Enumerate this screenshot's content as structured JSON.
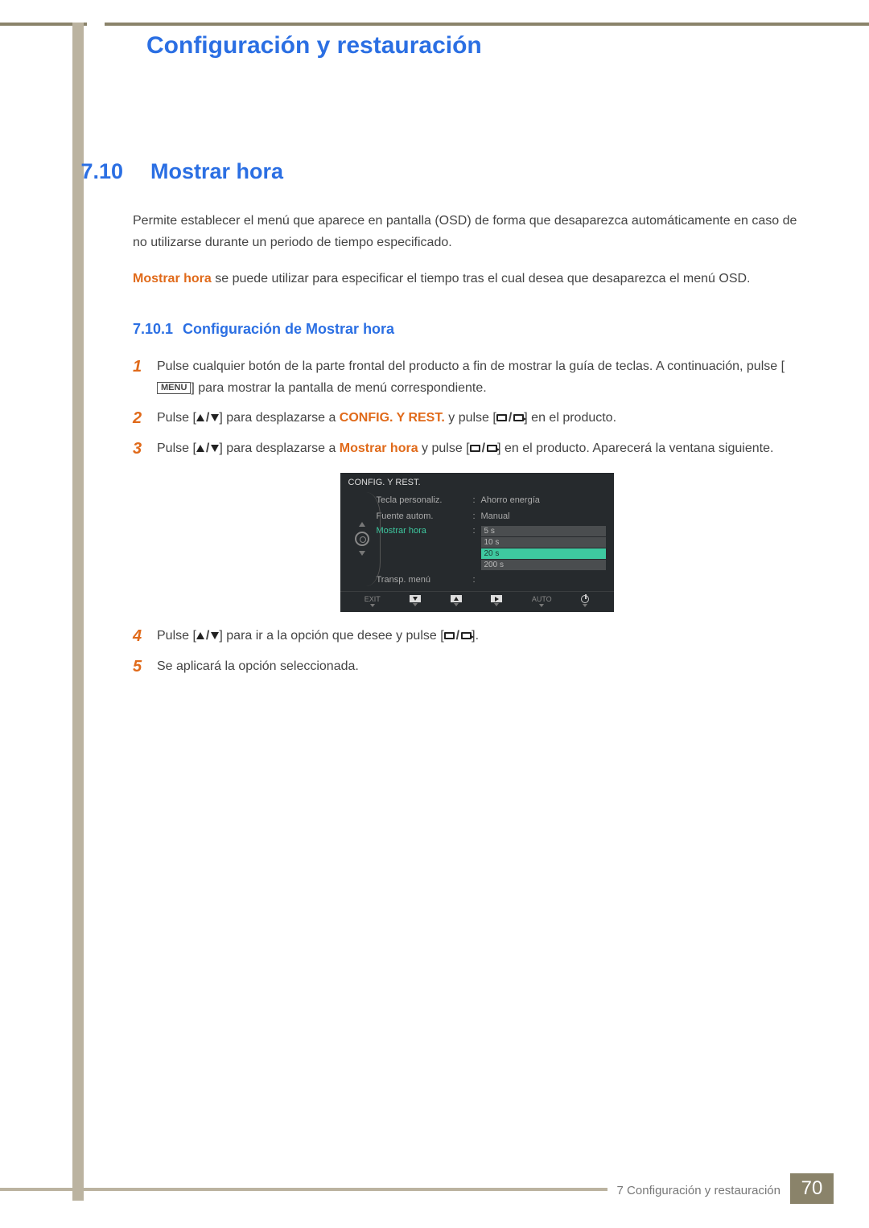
{
  "header": {
    "title": "Configuración y restauración"
  },
  "section": {
    "number": "7.10",
    "title": "Mostrar hora",
    "intro1": "Permite establecer el menú que aparece en pantalla (OSD) de forma que desaparezca automáticamente en caso de no utilizarse durante un periodo de tiempo especificado.",
    "intro2a": "Mostrar hora",
    "intro2b": " se puede utilizar para especificar el tiempo tras el cual desea que desaparezca el menú OSD."
  },
  "subsection": {
    "number": "7.10.1",
    "title": "Configuración de Mostrar hora"
  },
  "steps": {
    "s1a": "Pulse cualquier botón de la parte frontal del producto a fin de mostrar la guía de teclas. A continuación, pulse [",
    "s1menu": "MENU",
    "s1b": "] para mostrar la pantalla de menú correspondiente.",
    "s2a": "Pulse [",
    "s2b": "] para desplazarse a ",
    "s2c": "CONFIG. Y REST.",
    "s2d": " y pulse [",
    "s2e": "] en el producto.",
    "s3a": "Pulse [",
    "s3b": "] para desplazarse a ",
    "s3c": "Mostrar hora",
    "s3d": " y pulse [",
    "s3e": "] en el producto. Aparecerá la ventana siguiente.",
    "s4a": "Pulse [",
    "s4b": "] para ir a la opción que desee y pulse [",
    "s4c": "].",
    "s5": "Se aplicará la opción seleccionada."
  },
  "osd": {
    "title": "CONFIG. Y REST.",
    "rows": [
      {
        "label": "Tecla personaliz.",
        "value": "Ahorro energía"
      },
      {
        "label": "Fuente autom.",
        "value": "Manual"
      }
    ],
    "activeLabel": "Mostrar hora",
    "transp": "Transp. menú",
    "options": [
      "5 s",
      "10 s",
      "20 s",
      "200 s"
    ],
    "selected": "20 s",
    "nav": {
      "exit": "EXIT",
      "auto": "AUTO"
    }
  },
  "footer": {
    "chapter": "7 Configuración y restauración",
    "page": "70"
  }
}
